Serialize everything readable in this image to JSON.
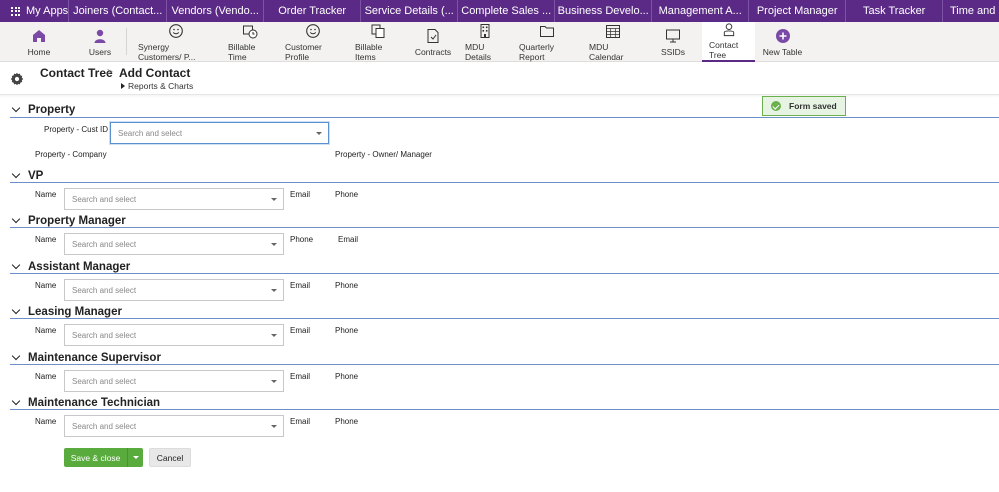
{
  "appbar": {
    "my_apps": "My Apps",
    "tabs": [
      "Joiners (Contact...",
      "Vendors (Vendo...",
      "Order Tracker",
      "Service Details (...",
      "Complete Sales ...",
      "Business Develo...",
      "Management A...",
      "Project Manager",
      "Task Tracker",
      "Time and"
    ]
  },
  "toolbar": {
    "items": [
      {
        "label": "Home",
        "icon": "home-icon"
      },
      {
        "label": "Users",
        "icon": "user-icon"
      },
      {
        "label": "Synergy Customers/ P...",
        "icon": "smiley-icon"
      },
      {
        "label": "Billable Time",
        "icon": "clock-icon"
      },
      {
        "label": "Customer Profile",
        "icon": "smiley-icon"
      },
      {
        "label": "Billable Items",
        "icon": "copy-icon"
      },
      {
        "label": "Contracts",
        "icon": "document-icon"
      },
      {
        "label": "MDU Details",
        "icon": "building-icon"
      },
      {
        "label": "Quarterly Report",
        "icon": "folder-icon"
      },
      {
        "label": "MDU Calendar",
        "icon": "calendar-icon"
      },
      {
        "label": "SSIDs",
        "icon": "monitor-icon"
      },
      {
        "label": "Contact Tree",
        "icon": "lock-person-icon"
      },
      {
        "label": "New Table",
        "icon": "plus-circle-icon"
      }
    ],
    "active": "Contact Tree"
  },
  "header": {
    "breadcrumb_home": "Contact Tree",
    "breadcrumb_sep": ">",
    "breadcrumb_current": "Add Contact",
    "reports_link": "Reports & Charts"
  },
  "toast": {
    "message": "Form saved"
  },
  "property": {
    "title": "Property",
    "cust_id_label": "Property - Cust ID",
    "cust_id_placeholder": "Search and select",
    "company_label": "Property - Company",
    "owner_label": "Property - Owner/ Manager"
  },
  "sections": [
    {
      "title": "VP",
      "name_label": "Name",
      "placeholder": "Search and select",
      "col1": "Email",
      "col2": "Phone"
    },
    {
      "title": "Property Manager",
      "name_label": "Name",
      "placeholder": "Search and select",
      "col1": "Phone",
      "col2": "Email"
    },
    {
      "title": "Assistant Manager",
      "name_label": "Name",
      "placeholder": "Search and select",
      "col1": "Email",
      "col2": "Phone"
    },
    {
      "title": "Leasing Manager",
      "name_label": "Name",
      "placeholder": "Search and select",
      "col1": "Email",
      "col2": "Phone"
    },
    {
      "title": "Maintenance Supervisor",
      "name_label": "Name",
      "placeholder": "Search and select",
      "col1": "Email",
      "col2": "Phone"
    },
    {
      "title": "Maintenance Technician",
      "name_label": "Name",
      "placeholder": "Search and select",
      "col1": "Email",
      "col2": "Phone"
    }
  ],
  "actions": {
    "save_label": "Save & close",
    "cancel_label": "Cancel"
  },
  "colors": {
    "brand": "#5b2a86",
    "save": "#5aab3e",
    "section_line": "#6b8fc6"
  }
}
